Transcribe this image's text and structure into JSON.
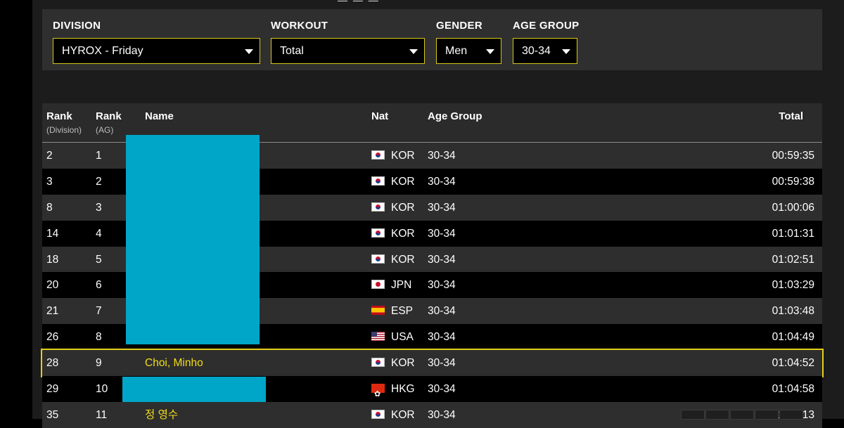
{
  "filters": {
    "division": {
      "label": "DIVISION",
      "value": "HYROX - Friday"
    },
    "workout": {
      "label": "WORKOUT",
      "value": "Total"
    },
    "gender": {
      "label": "GENDER",
      "value": "Men"
    },
    "age_group": {
      "label": "AGE GROUP",
      "value": "30-34"
    }
  },
  "table": {
    "headers": {
      "rank_division": "Rank",
      "rank_division_sub": "(Division)",
      "rank_ag": "Rank",
      "rank_ag_sub": "(AG)",
      "name": "Name",
      "nat": "Nat",
      "age_group": "Age Group",
      "total": "Total"
    },
    "rows": [
      {
        "rank": "2",
        "rank_ag": "1",
        "name": "",
        "nat": "KOR",
        "flag": "kr",
        "age_group": "30-34",
        "total": "00:59:35"
      },
      {
        "rank": "3",
        "rank_ag": "2",
        "name": "",
        "nat": "KOR",
        "flag": "kr",
        "age_group": "30-34",
        "total": "00:59:38"
      },
      {
        "rank": "8",
        "rank_ag": "3",
        "name": "",
        "nat": "KOR",
        "flag": "kr",
        "age_group": "30-34",
        "total": "01:00:06"
      },
      {
        "rank": "14",
        "rank_ag": "4",
        "name": "",
        "nat": "KOR",
        "flag": "kr",
        "age_group": "30-34",
        "total": "01:01:31"
      },
      {
        "rank": "18",
        "rank_ag": "5",
        "name": "",
        "nat": "KOR",
        "flag": "kr",
        "age_group": "30-34",
        "total": "01:02:51"
      },
      {
        "rank": "20",
        "rank_ag": "6",
        "name": "",
        "nat": "JPN",
        "flag": "jp",
        "age_group": "30-34",
        "total": "01:03:29"
      },
      {
        "rank": "21",
        "rank_ag": "7",
        "name": "",
        "nat": "ESP",
        "flag": "es",
        "age_group": "30-34",
        "total": "01:03:48"
      },
      {
        "rank": "26",
        "rank_ag": "8",
        "name": "",
        "nat": "USA",
        "flag": "us",
        "age_group": "30-34",
        "total": "01:04:49"
      },
      {
        "rank": "28",
        "rank_ag": "9",
        "name": "Choi, Minho",
        "nat": "KOR",
        "flag": "kr",
        "age_group": "30-34",
        "total": "01:04:52"
      },
      {
        "rank": "29",
        "rank_ag": "10",
        "name": "",
        "nat": "HKG",
        "flag": "hk",
        "age_group": "30-34",
        "total": "01:04:58"
      },
      {
        "rank": "35",
        "rank_ag": "11",
        "name": "정 영수",
        "nat": "KOR",
        "flag": "kr",
        "age_group": "30-34",
        "total": "01:06:13"
      }
    ]
  },
  "colors": {
    "accent": "#e3cf1c",
    "redaction": "#00a6c8"
  }
}
